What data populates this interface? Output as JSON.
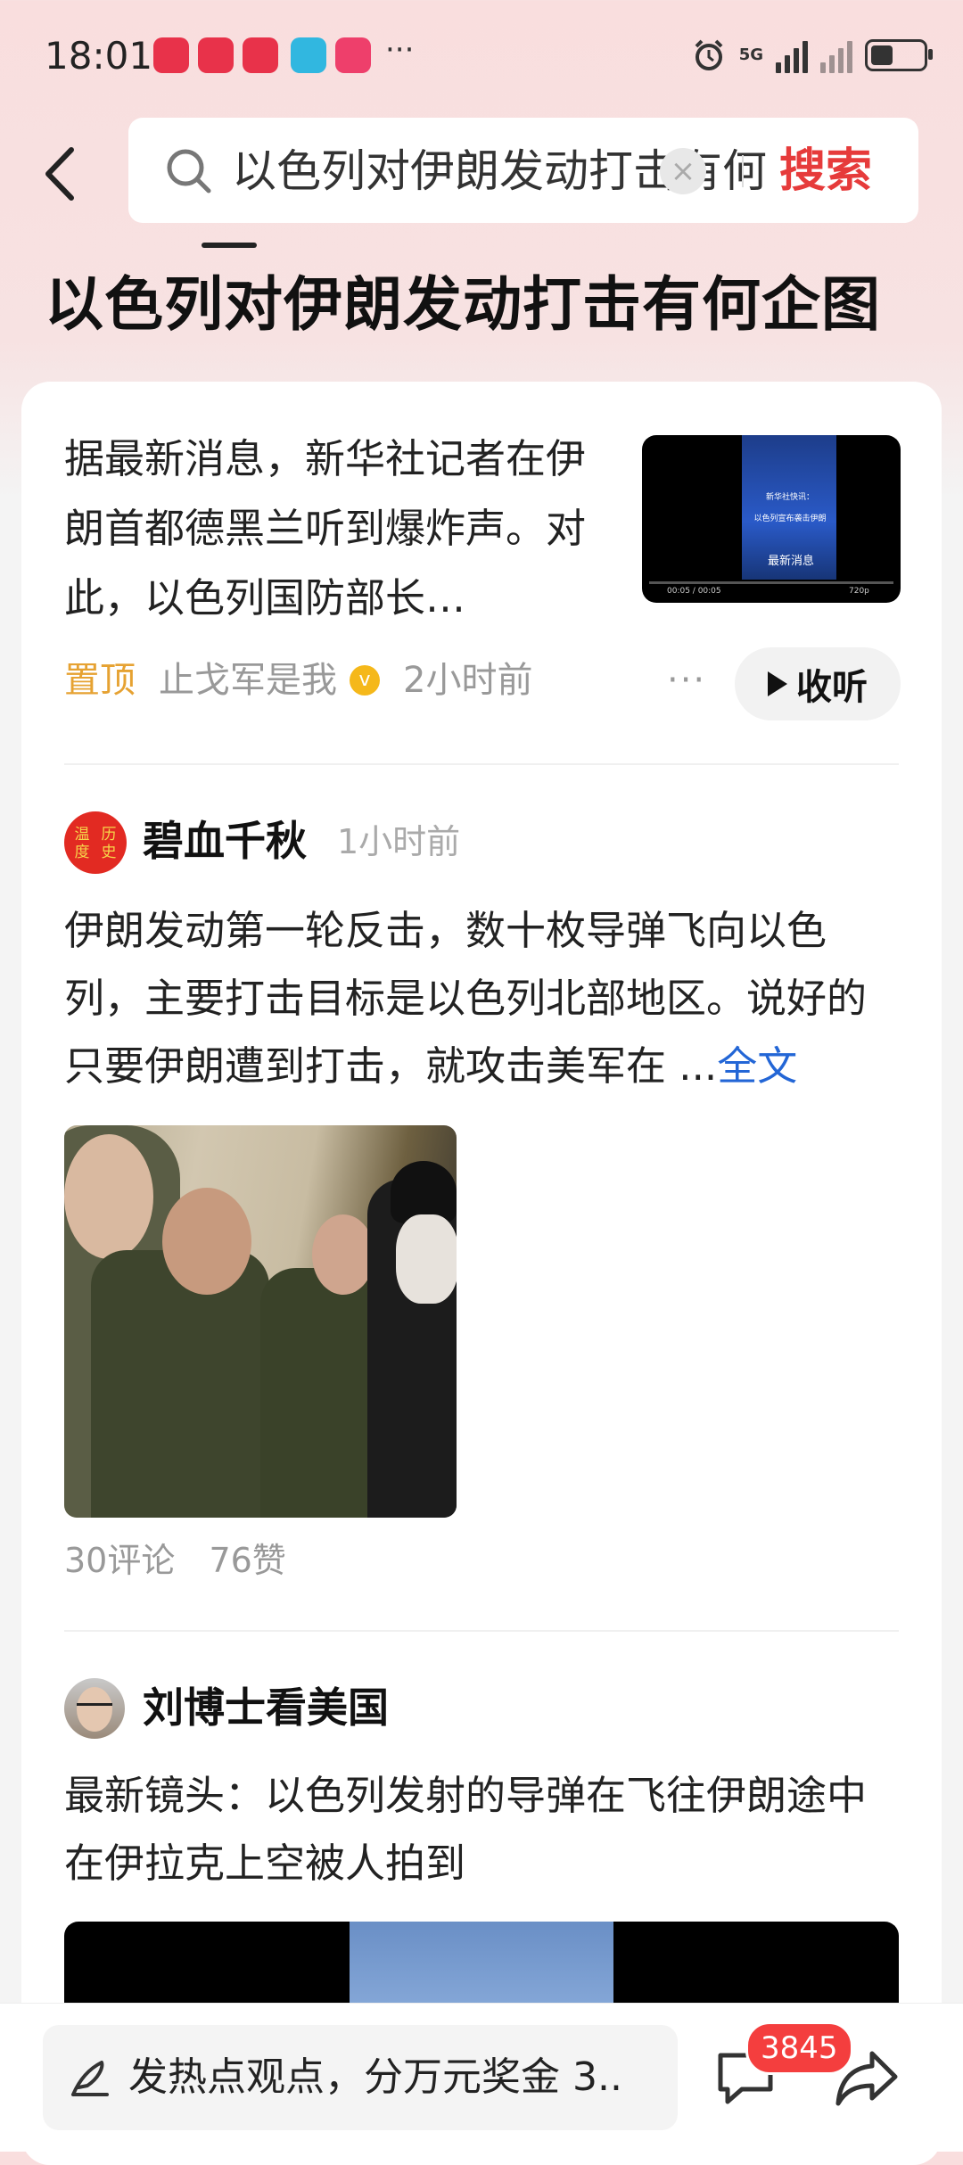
{
  "status_bar": {
    "time": "18:01",
    "network": "5G",
    "more": "···",
    "icons": [
      "money-app-icon",
      "money-app-icon",
      "money-app-icon",
      "book-app-icon",
      "video-app-icon",
      "alarm-icon",
      "signal-icon",
      "signal-icon",
      "battery-icon"
    ]
  },
  "search": {
    "query": "以色列对伊朗发动打击有何企图",
    "button_label": "搜索",
    "clear_symbol": "×"
  },
  "page": {
    "title": "以色列对伊朗发动打击有何企图"
  },
  "news_item": {
    "summary": "据最新消息，新华社记者在伊朗首都德黑兰听到爆炸声。对此，以色列国防部长…",
    "pin_label": "置顶",
    "author": "止戈军是我",
    "verified_mark": "v",
    "time": "2小时前",
    "more": "···",
    "listen_label": "收听",
    "thumb": {
      "caption_1": "新华社快讯：",
      "caption_2": "以色列宣布袭击伊朗",
      "caption_3": "最新消息",
      "time_current": "00:05 / 00:05",
      "quality": "720p"
    }
  },
  "post_1": {
    "author": "碧血千秋",
    "avatar_text_left": "温度",
    "avatar_text_right": "历史",
    "time": "1小时前",
    "text": "伊朗发动第一轮反击，数十枚导弹飞向以色列，主要打击目标是以色列北部地区。说好的只要伊朗遭到打击，就攻击美军在 ...",
    "full_text_link": "全文",
    "comments": "30评论",
    "likes": "76赞"
  },
  "post_2": {
    "author": "刘博士看美国",
    "text": "最新镜头：以色列发射的导弹在飞往伊朗途中在伊拉克上空被人拍到"
  },
  "bottom_bar": {
    "comment_placeholder": "发热点观点，分万元奖金 3..",
    "comment_count": "3845"
  }
}
